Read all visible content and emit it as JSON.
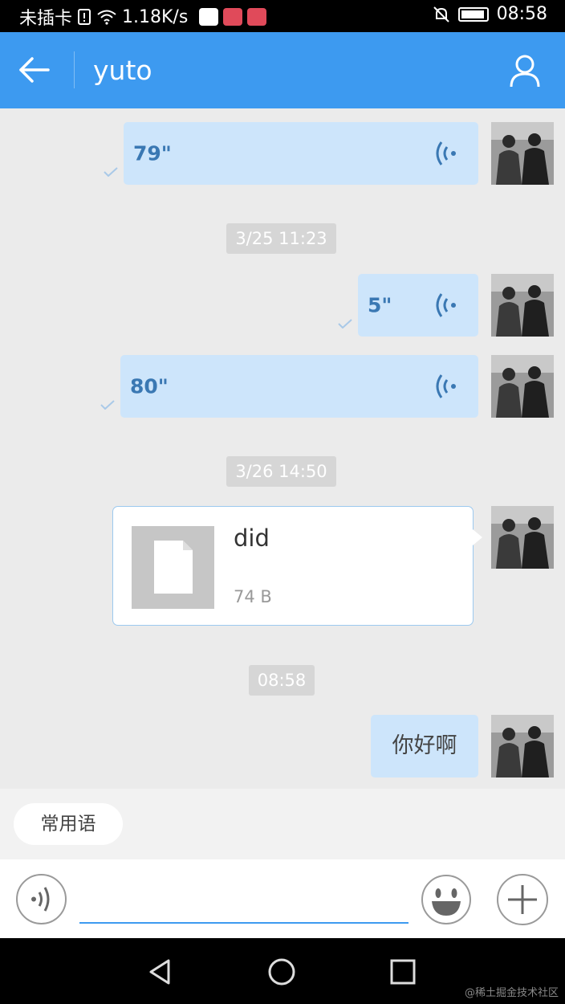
{
  "status_bar": {
    "carrier": "未插卡",
    "speed": "1.18K/s",
    "time": "08:58"
  },
  "header": {
    "title": "yuto",
    "icons": [
      "back-arrow-icon",
      "person-icon"
    ]
  },
  "messages": [
    {
      "type": "voice",
      "duration": "79\"",
      "read": true
    },
    {
      "type": "timestamp",
      "text": "3/25 11:23"
    },
    {
      "type": "voice",
      "duration": "5\"",
      "read": true
    },
    {
      "type": "voice",
      "duration": "80\"",
      "read": true
    },
    {
      "type": "timestamp",
      "text": "3/26 14:50"
    },
    {
      "type": "file",
      "name": "did",
      "size": "74 B"
    },
    {
      "type": "timestamp",
      "text": "08:58"
    },
    {
      "type": "text",
      "text": "你好啊"
    }
  ],
  "quick_phrases": {
    "label": "常用语"
  },
  "input": {
    "value": "",
    "placeholder": ""
  },
  "colors": {
    "accent": "#3d9af0",
    "bubble": "#cde5fb",
    "bubble_text": "#3a78b3",
    "background": "#ebebeb"
  },
  "watermark": "@稀土掘金技术社区"
}
